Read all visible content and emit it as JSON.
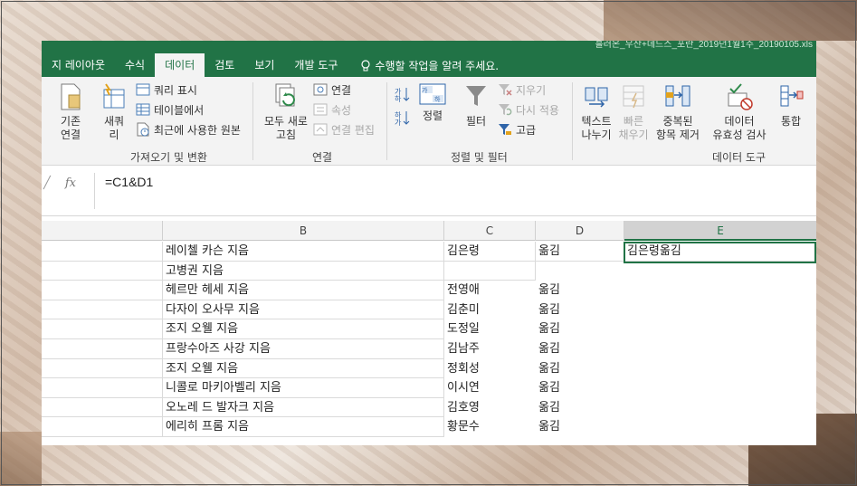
{
  "window": {
    "title_fragment": "흘러온_우산+데드스_포란_2019년1월1주_20190105.xls"
  },
  "tabs": [
    {
      "label": "지 레이아웃"
    },
    {
      "label": "수식"
    },
    {
      "label": "데이터",
      "active": true
    },
    {
      "label": "검토"
    },
    {
      "label": "보기"
    },
    {
      "label": "개발 도구"
    }
  ],
  "tell_me": {
    "placeholder": "수행할 작업을 알려 주세요."
  },
  "ribbon": {
    "get_transform": {
      "existing_conn": "기존\n연결",
      "new_query": "새쿼\n리",
      "show_queries": "쿼리 표시",
      "from_table": "테이블에서",
      "recent_sources": "최근에 사용한 원본",
      "group_label": "가져오기 및 변환"
    },
    "connections": {
      "refresh_all": "모두 새로\n고침",
      "connections": "연결",
      "properties": "속성",
      "edit_links": "연결 편집",
      "group_label": "연결"
    },
    "sort_filter": {
      "sort": "정렬",
      "filter": "필터",
      "clear": "지우기",
      "reapply": "다시 적용",
      "advanced": "고급",
      "group_label": "정렬 및 필터"
    },
    "data_tools": {
      "text_to_columns": "텍스트\n나누기",
      "flash_fill": "빠른\n채우기",
      "remove_duplicates": "중복된\n항목 제거",
      "data_validation": "데이터\n유효성 검사",
      "consolidate": "통합",
      "group_label": "데이터 도구"
    }
  },
  "formula_bar": {
    "fx_symbol": "fx",
    "formula": "=C1&D1"
  },
  "columns": [
    "B",
    "C",
    "D",
    "E"
  ],
  "rows": [
    {
      "b": "레이첼 카슨 지음",
      "c": "김은령",
      "d": "옮김",
      "e": "김은령옮김"
    },
    {
      "b": "고병권 지음",
      "c": "",
      "d": "",
      "e": ""
    },
    {
      "b": "헤르만 헤세 지음",
      "c": "전영애",
      "d": "옮김",
      "e": ""
    },
    {
      "b": "다자이 오사무 지음",
      "c": "김춘미",
      "d": "옮김",
      "e": ""
    },
    {
      "b": "조지 오웰 지음",
      "c": "도정일",
      "d": "옮김",
      "e": ""
    },
    {
      "b": "프랑수아즈 사강 지음",
      "c": "김남주",
      "d": "옮김",
      "e": ""
    },
    {
      "b": "조지 오웰 지음",
      "c": "정회성",
      "d": "옮김",
      "e": ""
    },
    {
      "b": "니콜로 마키아벨리 지음",
      "c": "이시연",
      "d": "옮김",
      "e": ""
    },
    {
      "b": "오노레 드 발자크 지음",
      "c": "김호영",
      "d": "옮김",
      "e": ""
    },
    {
      "b": "에리히 프롬 지음",
      "c": "황문수",
      "d": "옮김",
      "e": ""
    }
  ],
  "colors": {
    "excel_green": "#217346",
    "ribbon_bg": "#f3f3f3"
  }
}
